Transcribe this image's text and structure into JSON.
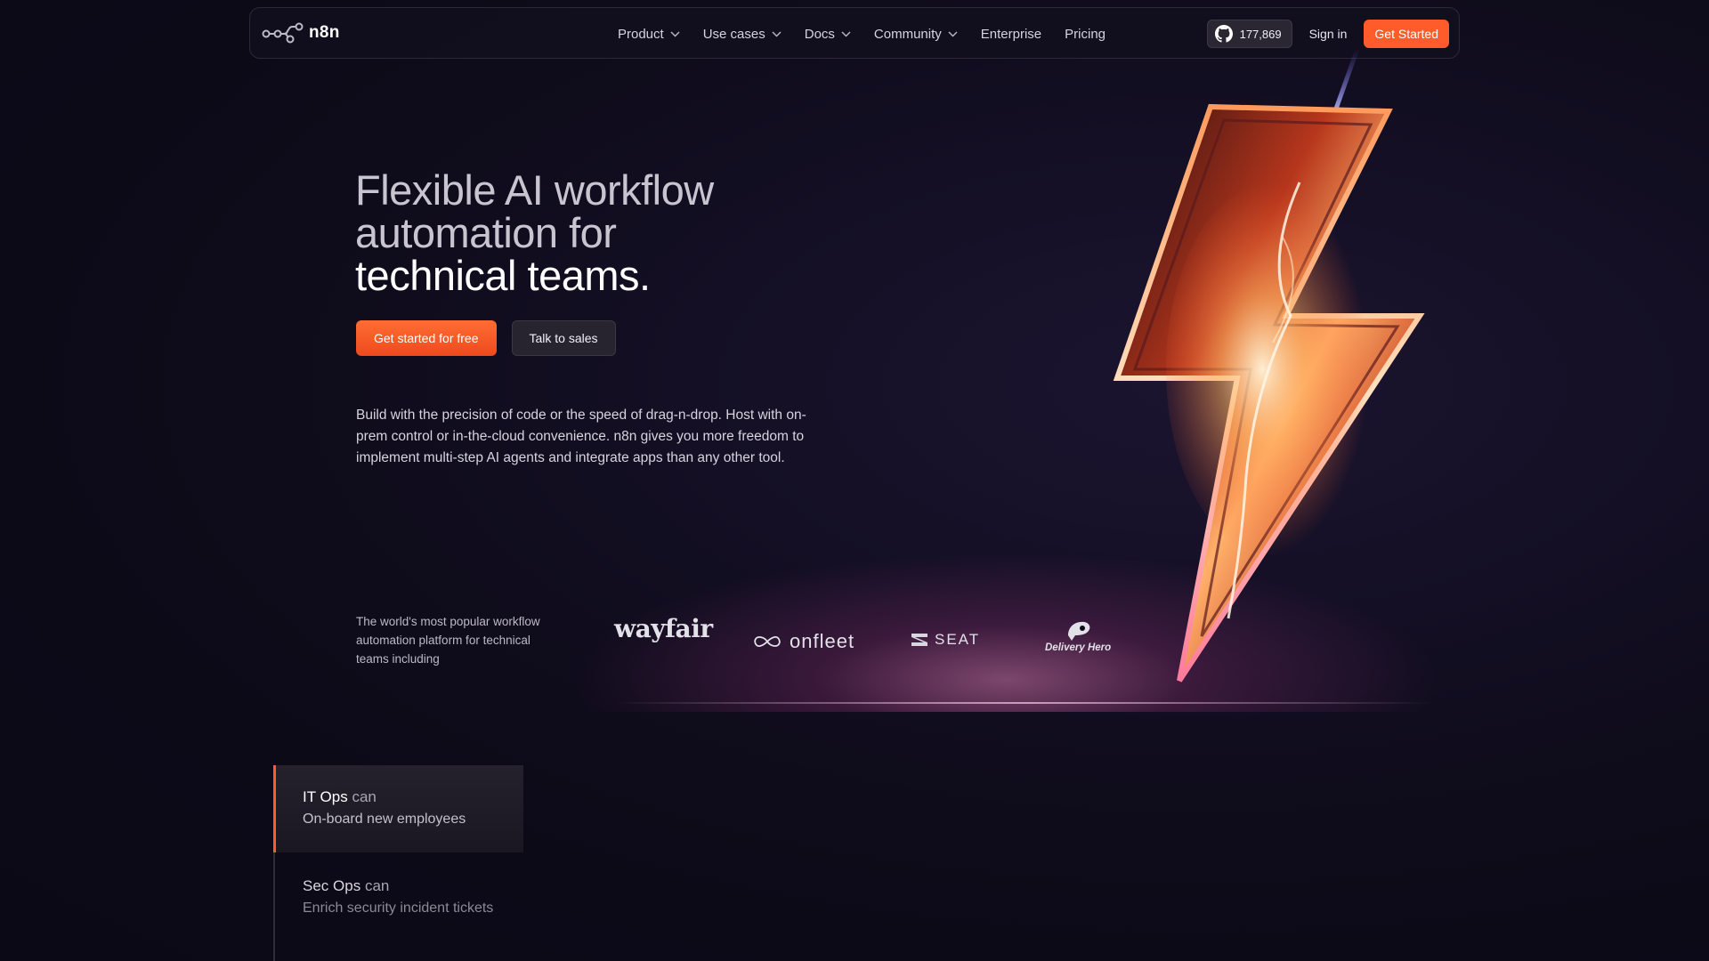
{
  "nav": {
    "logo_text": "n8n",
    "links": [
      {
        "label": "Product",
        "dropdown": true
      },
      {
        "label": "Use cases",
        "dropdown": true
      },
      {
        "label": "Docs",
        "dropdown": true
      },
      {
        "label": "Community",
        "dropdown": true
      },
      {
        "label": "Enterprise",
        "dropdown": false
      },
      {
        "label": "Pricing",
        "dropdown": false
      }
    ],
    "github_stars": "177,869",
    "sign_in": "Sign in",
    "cta": "Get Started"
  },
  "hero": {
    "title_line1": "Flexible AI workflow",
    "title_line2": "automation for",
    "title_line3": "technical teams.",
    "primary_cta": "Get started for free",
    "secondary_cta": "Talk to sales",
    "description": "Build with the precision of code or the speed of drag-n-drop. Host with on-prem control or in-the-cloud convenience. n8n gives you more freedom to implement multi-step AI agents and integrate apps than any other tool."
  },
  "trusted": {
    "text": "The world's most popular workflow automation platform for technical teams including",
    "brands": [
      "wayfair",
      "onfleet",
      "SEAT",
      "Delivery Hero"
    ]
  },
  "use_cases": [
    {
      "team": "IT Ops",
      "can": "can",
      "task": "On-board new employees",
      "active": true
    },
    {
      "team": "Sec Ops",
      "can": "can",
      "task": "Enrich security incident tickets",
      "active": false
    }
  ],
  "colors": {
    "accent": "#ff5b2b",
    "background": "#0e0b1a"
  }
}
